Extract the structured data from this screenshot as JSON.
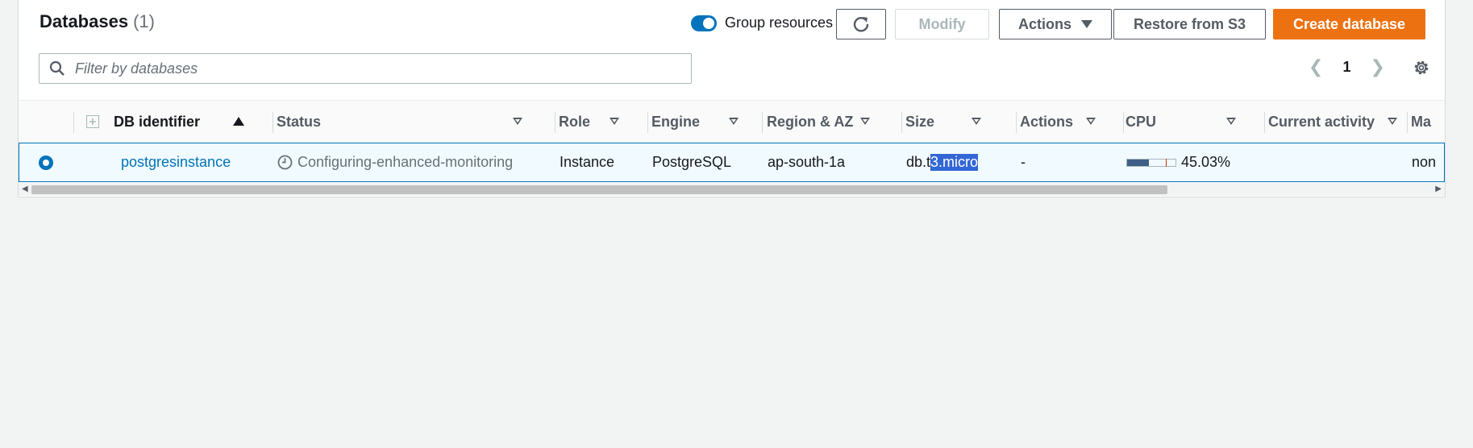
{
  "header": {
    "title": "Databases",
    "count": "(1)"
  },
  "toolbar": {
    "group_resources_label": "Group resources",
    "modify_label": "Modify",
    "actions_label": "Actions",
    "restore_label": "Restore from S3",
    "create_label": "Create database"
  },
  "search": {
    "placeholder": "Filter by databases"
  },
  "pagination": {
    "current_page": "1"
  },
  "table": {
    "columns": [
      "DB identifier",
      "Status",
      "Role",
      "Engine",
      "Region & AZ",
      "Size",
      "Actions",
      "CPU",
      "Current activity",
      "Ma"
    ],
    "rows": [
      {
        "db_identifier": "postgresinstance",
        "status": "Configuring-enhanced-monitoring",
        "role": "Instance",
        "engine": "PostgreSQL",
        "region_az": "ap-south-1a",
        "size_prefix": "db.t",
        "size_selected": "3.micro",
        "actions": "-",
        "cpu_text": "45.03%",
        "cpu_percent": 45.03,
        "current_activity": "",
        "maintenance": "non"
      }
    ]
  },
  "colors": {
    "primary": "#ec7211",
    "accent": "#0073bb",
    "selection": "#3367d6"
  },
  "icons": {
    "search": "search-icon",
    "refresh": "refresh-icon",
    "settings": "gear-icon",
    "status": "clock-icon"
  }
}
